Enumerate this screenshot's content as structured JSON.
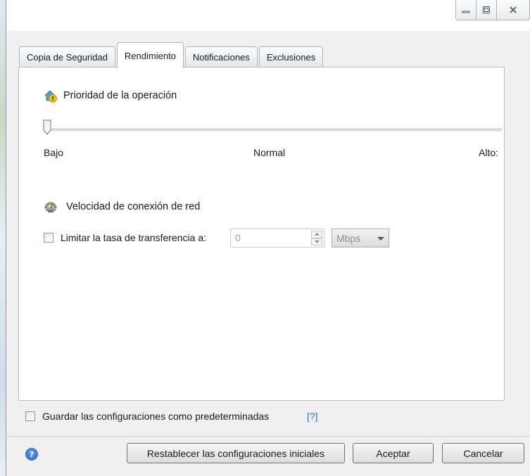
{
  "window": {
    "caption_buttons": [
      "minimize-icon",
      "maximize-icon",
      "close-icon"
    ]
  },
  "tabs": [
    {
      "label": "Copia de Seguridad",
      "active": false
    },
    {
      "label": "Rendimiento",
      "active": true
    },
    {
      "label": "Notificaciones",
      "active": false
    },
    {
      "label": "Exclusiones",
      "active": false
    }
  ],
  "priority": {
    "title": "Prioridad de la operación",
    "icon": "priority-warning-icon",
    "slider_value": 0,
    "labels": {
      "low": "Bajo",
      "normal": "Normal",
      "high": "Alto:"
    }
  },
  "network": {
    "title": "Velocidad de conexión de red",
    "icon": "network-speed-icon",
    "limit_label": "Limitar la tasa de transferencia a:",
    "limit_checked": false,
    "rate_value": "0",
    "unit": "Mbps"
  },
  "save_defaults": {
    "label": "Guardar las configuraciones como predeterminadas",
    "help": "[?]",
    "checked": false
  },
  "footer": {
    "reset_label": "Restablecer las configuraciones iniciales",
    "ok_label": "Aceptar",
    "cancel_label": "Cancelar"
  },
  "colors": {
    "accent": "#2a6fd6",
    "help_icon": "#3b82d8"
  }
}
